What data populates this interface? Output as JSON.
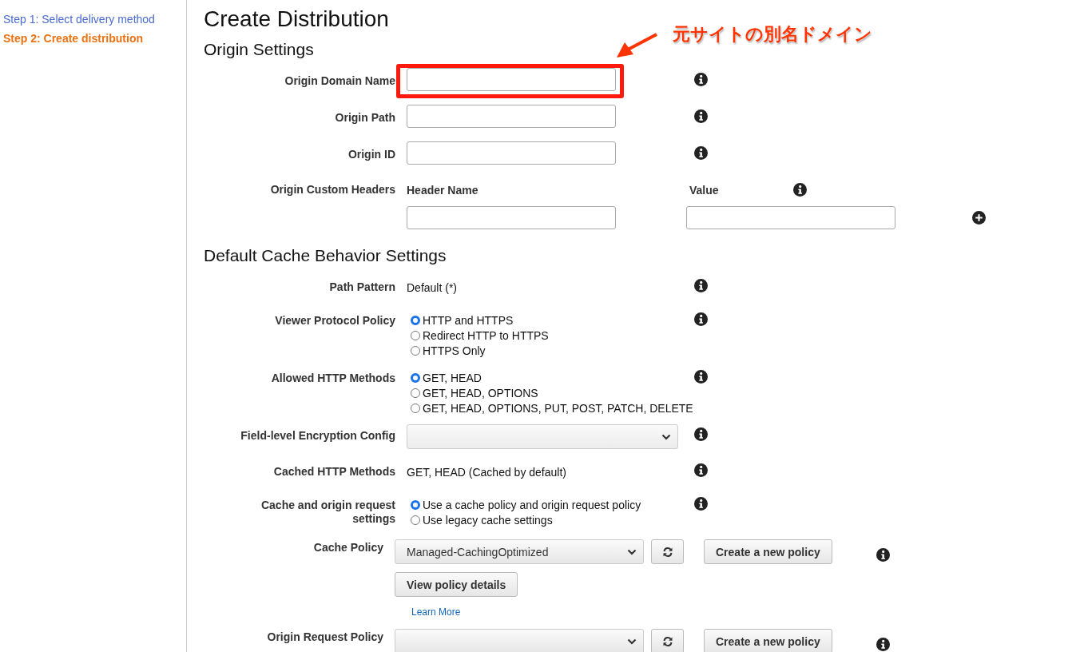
{
  "sidebar": {
    "steps": [
      {
        "label": "Step 1: Select delivery method",
        "selected": false
      },
      {
        "label": "Step 2: Create distribution",
        "selected": true
      }
    ]
  },
  "page_title": "Create Distribution",
  "sections": [
    {
      "title": "Origin Settings",
      "rows": [
        {
          "kind": "text_input",
          "label": "Origin Domain Name",
          "highlighted": true
        },
        {
          "kind": "text_input",
          "label": "Origin Path",
          "highlighted": false
        },
        {
          "kind": "text_input",
          "label": "Origin ID",
          "highlighted": false
        },
        {
          "kind": "header_pair",
          "label": "Origin Custom Headers",
          "name_heading": "Header Name",
          "value_heading": "Value"
        }
      ]
    },
    {
      "title": "Default Cache Behavior Settings",
      "rows": [
        {
          "kind": "static",
          "label": "Path Pattern",
          "value": "Default (*)"
        },
        {
          "kind": "radio",
          "label": "Viewer Protocol Policy",
          "options": [
            {
              "label": "HTTP and HTTPS",
              "selected": true
            },
            {
              "label": "Redirect HTTP to HTTPS",
              "selected": false
            },
            {
              "label": "HTTPS Only",
              "selected": false
            }
          ]
        },
        {
          "kind": "radio",
          "label": "Allowed HTTP Methods",
          "options": [
            {
              "label": "GET, HEAD",
              "selected": true
            },
            {
              "label": "GET, HEAD, OPTIONS",
              "selected": false
            },
            {
              "label": "GET, HEAD, OPTIONS, PUT, POST, PATCH, DELETE",
              "selected": false
            }
          ]
        },
        {
          "kind": "select",
          "label": "Field-level Encryption Config"
        },
        {
          "kind": "static",
          "label": "Cached HTTP Methods",
          "value": "GET, HEAD (Cached by default)"
        },
        {
          "kind": "radio",
          "label": "Cache and origin request settings",
          "options": [
            {
              "label": "Use a cache policy and origin request policy",
              "selected": true
            },
            {
              "label": "Use legacy cache settings",
              "selected": false
            }
          ]
        },
        {
          "kind": "policy",
          "label": "Cache Policy",
          "value": "Managed-CachingOptimized",
          "create_button": "Create a new policy",
          "details_button": "View policy details",
          "link": "Learn More"
        },
        {
          "kind": "policy",
          "label": "Origin Request Policy",
          "create_button": "Create a new policy"
        }
      ]
    }
  ],
  "annotation": {
    "text": "元サイトの別名ドメイン"
  }
}
